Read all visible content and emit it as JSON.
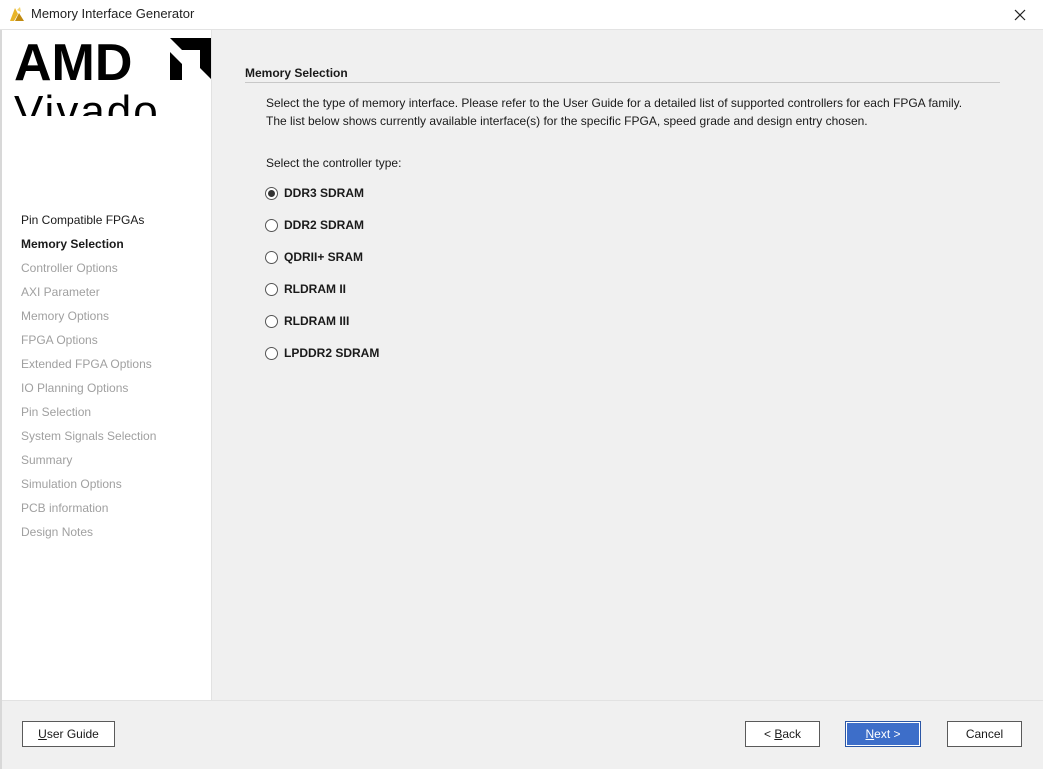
{
  "window": {
    "title": "Memory Interface Generator",
    "close_glyph": "✕"
  },
  "logo": {
    "brand": "AMD",
    "product": "Vivado"
  },
  "steps": [
    {
      "label": "Pin Compatible FPGAs",
      "state": "done"
    },
    {
      "label": "Memory Selection",
      "state": "current"
    },
    {
      "label": "Controller Options",
      "state": "pending"
    },
    {
      "label": "AXI Parameter",
      "state": "pending"
    },
    {
      "label": "Memory Options",
      "state": "pending"
    },
    {
      "label": "FPGA Options",
      "state": "pending"
    },
    {
      "label": "Extended FPGA Options",
      "state": "pending"
    },
    {
      "label": "IO Planning Options",
      "state": "pending"
    },
    {
      "label": "Pin Selection",
      "state": "pending"
    },
    {
      "label": "System Signals Selection",
      "state": "pending"
    },
    {
      "label": "Summary",
      "state": "pending"
    },
    {
      "label": "Simulation Options",
      "state": "pending"
    },
    {
      "label": "PCB information",
      "state": "pending"
    },
    {
      "label": "Design Notes",
      "state": "pending"
    }
  ],
  "main": {
    "section_title": "Memory Selection",
    "description_line1": "Select the type of memory interface. Please refer to the User Guide for a detailed list of supported controllers for each FPGA family.",
    "description_line2": "The list below shows currently available interface(s) for the specific FPGA, speed grade and design entry chosen.",
    "controller_label": "Select the controller type:",
    "options": [
      {
        "label": "DDR3 SDRAM",
        "selected": true
      },
      {
        "label": "DDR2 SDRAM",
        "selected": false
      },
      {
        "label": "QDRII+ SRAM",
        "selected": false
      },
      {
        "label": "RLDRAM II",
        "selected": false
      },
      {
        "label": "RLDRAM III",
        "selected": false
      },
      {
        "label": "LPDDR2 SDRAM",
        "selected": false
      }
    ]
  },
  "buttons": {
    "user_guide": {
      "mnemonic": "U",
      "rest": "ser Guide"
    },
    "back": {
      "prefix": "< ",
      "mnemonic": "B",
      "rest": "ack"
    },
    "next": {
      "mnemonic": "N",
      "rest": "ext >"
    },
    "cancel": "Cancel"
  },
  "colors": {
    "primary_button": "#3d6ec9",
    "window_bg": "#f0f0f0",
    "panel_bg": "#ffffff",
    "pending_step": "#a0a0a0"
  }
}
